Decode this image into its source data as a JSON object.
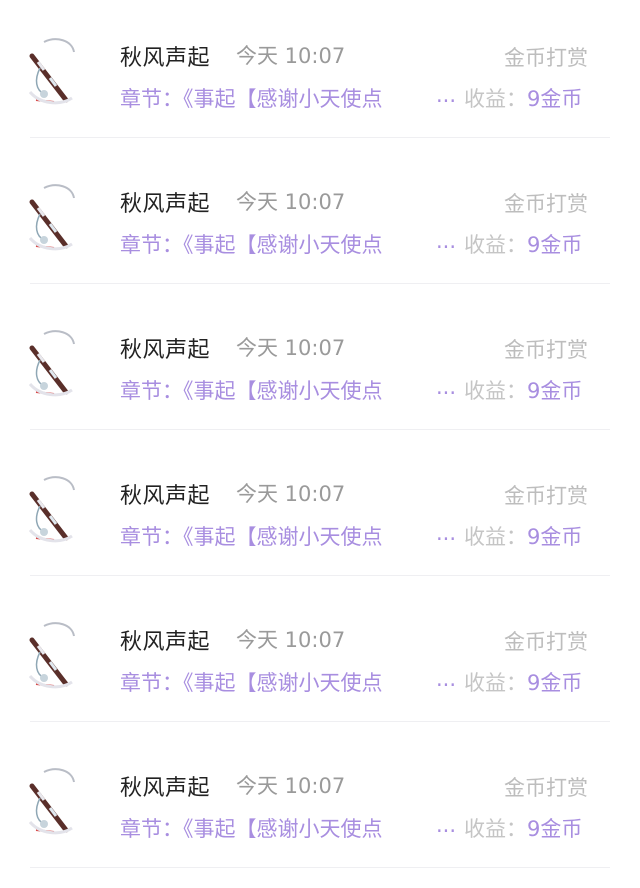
{
  "notifications": [
    {
      "user": "秋风声起",
      "time": "今天 10:07",
      "type": "金币打赏",
      "chapter": "章节：《事起【感谢小天使点",
      "ellipsis": "...",
      "income_label": "收益：",
      "income_value": "9金币"
    },
    {
      "user": "秋风声起",
      "time": "今天 10:07",
      "type": "金币打赏",
      "chapter": "章节：《事起【感谢小天使点",
      "ellipsis": "...",
      "income_label": "收益：",
      "income_value": "9金币"
    },
    {
      "user": "秋风声起",
      "time": "今天 10:07",
      "type": "金币打赏",
      "chapter": "章节：《事起【感谢小天使点",
      "ellipsis": "...",
      "income_label": "收益：",
      "income_value": "9金币"
    },
    {
      "user": "秋风声起",
      "time": "今天 10:07",
      "type": "金币打赏",
      "chapter": "章节：《事起【感谢小天使点",
      "ellipsis": "...",
      "income_label": "收益：",
      "income_value": "9金币"
    },
    {
      "user": "秋风声起",
      "time": "今天 10:07",
      "type": "金币打赏",
      "chapter": "章节：《事起【感谢小天使点",
      "ellipsis": "...",
      "income_label": "收益：",
      "income_value": "9金币"
    },
    {
      "user": "秋风声起",
      "time": "今天 10:07",
      "type": "金币打赏",
      "chapter": "章节：《事起【感谢小天使点",
      "ellipsis": "...",
      "income_label": "收益：",
      "income_value": "9金币"
    }
  ],
  "colors": {
    "accent": "#a88ee0",
    "name": "#222222",
    "time": "#9a9a9a",
    "muted": "#bdbdbd"
  },
  "avatar_icon": "flute-tassel-avatar-icon"
}
